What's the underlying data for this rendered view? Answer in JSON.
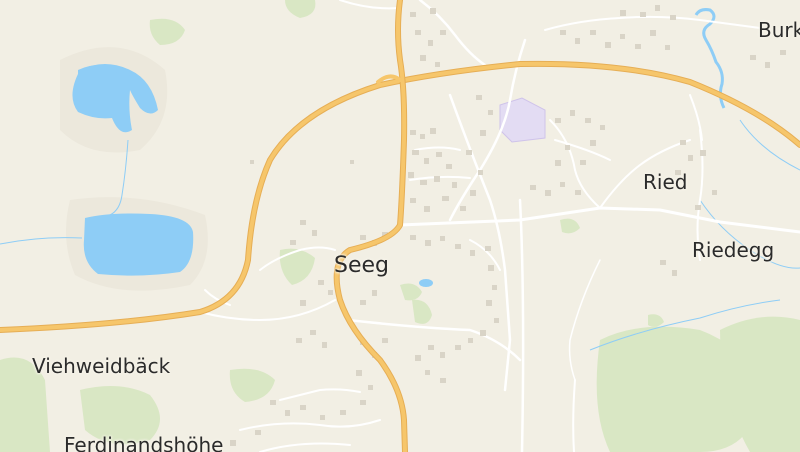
{
  "map": {
    "places": [
      {
        "id": "seeg",
        "name": "Seeg"
      },
      {
        "id": "ried",
        "name": "Ried"
      },
      {
        "id": "riedegg",
        "name": "Riedegg"
      },
      {
        "id": "viehweidbaeck",
        "name": "Viehweidbäck"
      },
      {
        "id": "ferdinandshoehe",
        "name": "Ferdinandshöhe"
      },
      {
        "id": "burk",
        "name": "Burk"
      }
    ],
    "colors": {
      "background": "#f2efe4",
      "water": "#8ecdf6",
      "forest": "#d9e7c4",
      "main_road": "#f6c66b",
      "main_road_casing": "#e6ae55",
      "minor_road": "#ffffff",
      "building": "#d9d4c7",
      "special_area": "#e3dcf3",
      "label": "#2b2b2b"
    }
  }
}
